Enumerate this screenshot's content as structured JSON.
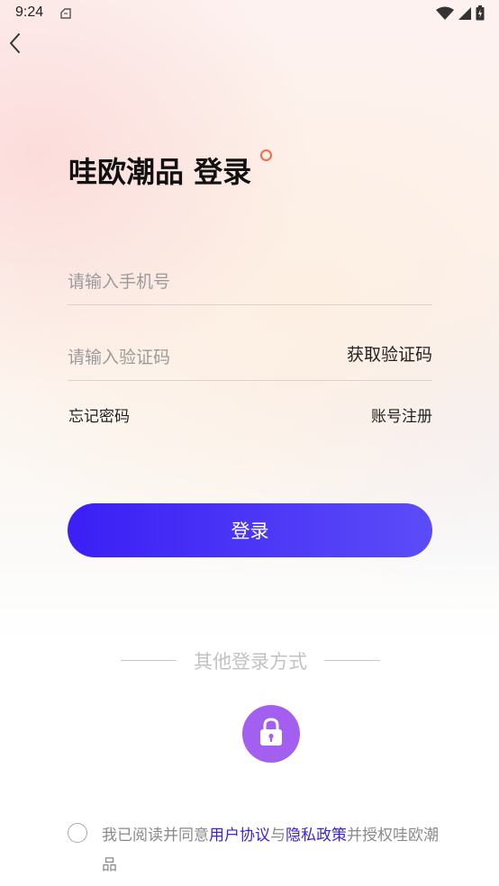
{
  "status_bar": {
    "time": "9:24",
    "icons": [
      "notification-icon",
      "wifi-icon",
      "signal-icon",
      "battery-icon"
    ]
  },
  "header": {
    "back_icon": "chevron-left-icon"
  },
  "title": "哇欧潮品 登录",
  "form": {
    "phone_placeholder": "请输入手机号",
    "phone_value": "",
    "code_placeholder": "请输入验证码",
    "code_value": "",
    "get_code_label": "获取验证码"
  },
  "links": {
    "forgot_password": "忘记密码",
    "register": "账号注册"
  },
  "login_button": "登录",
  "other_login": {
    "label": "其他登录方式",
    "options": [
      "lock-icon"
    ]
  },
  "agreement": {
    "checked": false,
    "prefix": "我已阅读并同意",
    "user_agreement": "用户协议",
    "joiner": "与",
    "privacy_policy": "隐私政策",
    "suffix": "并授权哇欧潮品"
  },
  "colors": {
    "primary": "#3b1ff5",
    "primary_end": "#5b4cf8",
    "link": "#3b24d6",
    "lock_bg": "#a35ff0",
    "title_dot": "#f26b4a"
  }
}
